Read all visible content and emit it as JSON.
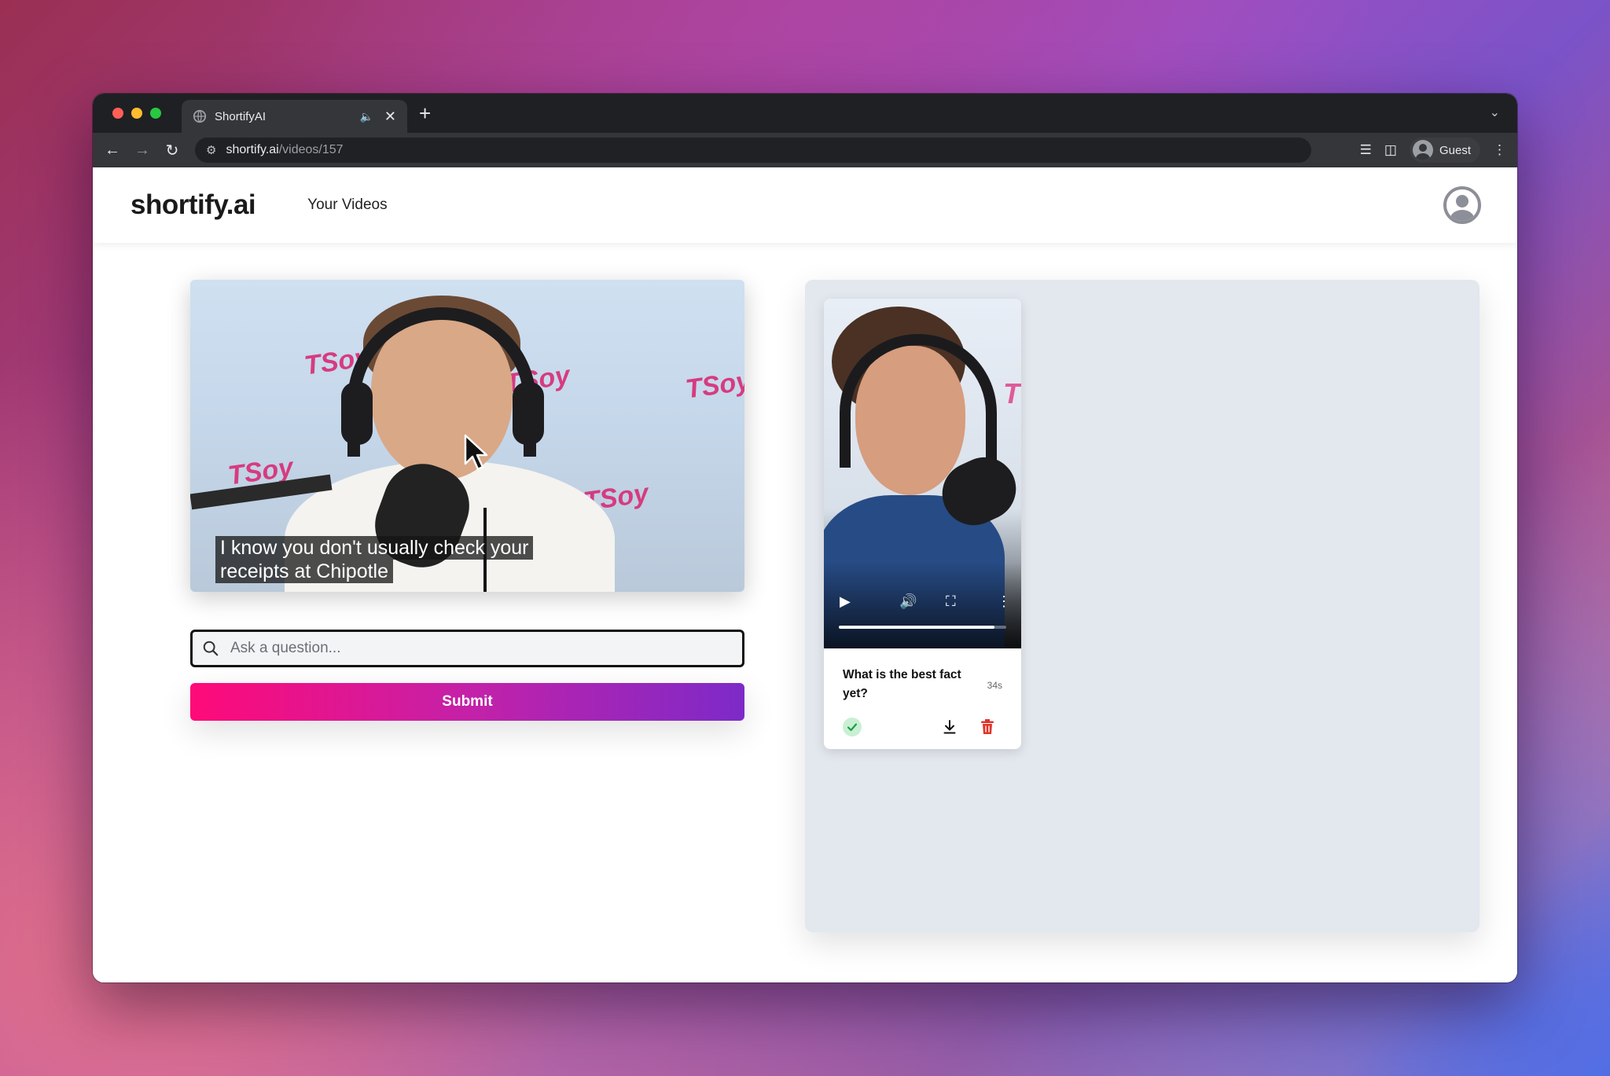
{
  "browser": {
    "tab_title": "ShortifyAI",
    "url_host": "shortify.ai",
    "url_path": "/videos/157",
    "profile_label": "Guest"
  },
  "header": {
    "logo": "shortify.ai",
    "nav_link": "Your Videos"
  },
  "main_video": {
    "caption_line1": "I know you don't usually check your",
    "caption_line2": "receipts at Chipotle",
    "watermark": "TSoy"
  },
  "question": {
    "placeholder": "Ask a question...",
    "value": ""
  },
  "submit_label": "Submit",
  "clips": [
    {
      "title": "What is the best fact yet?",
      "duration": "34s",
      "status": "complete",
      "progress": 0.93
    }
  ],
  "colors": {
    "gradient_start": "#ff0a78",
    "gradient_end": "#7d2ac8",
    "panel_bg": "#e3e7ee",
    "delete": "#e0352b",
    "check": "#1e9e4a"
  }
}
